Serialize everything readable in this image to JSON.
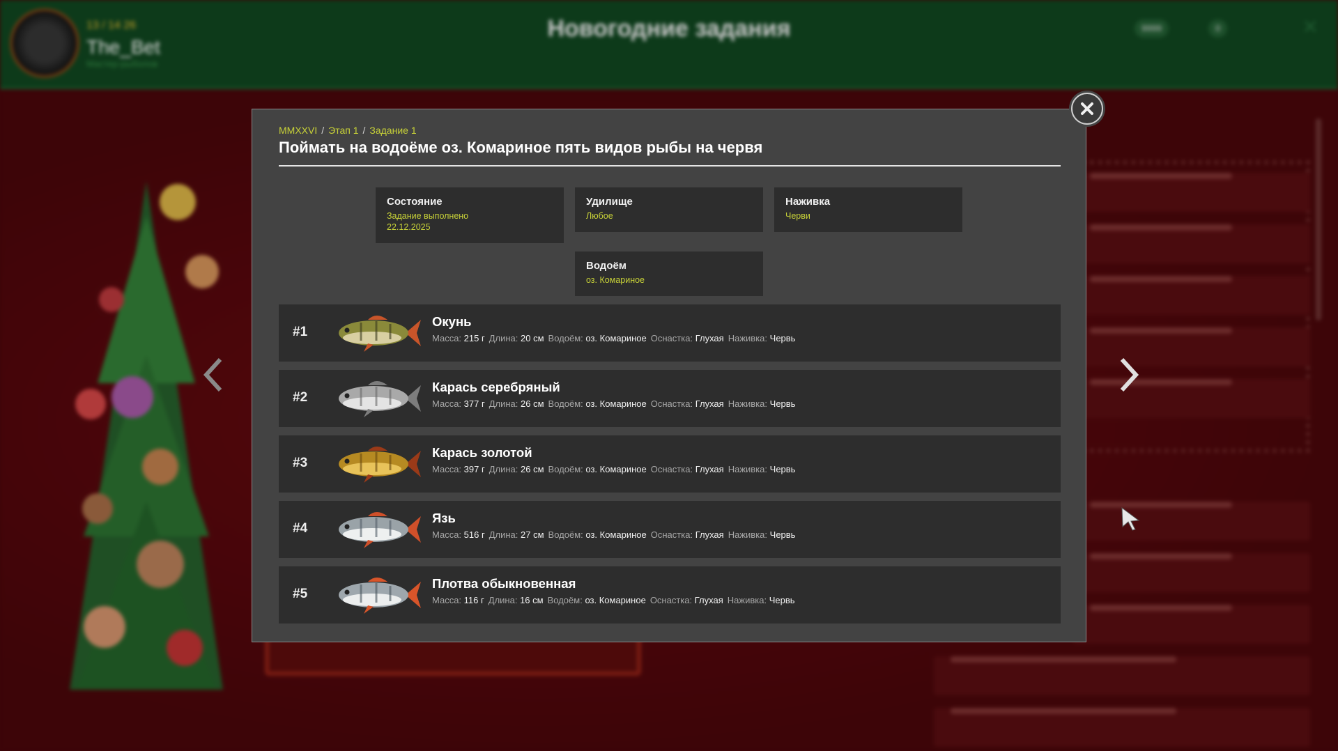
{
  "header": {
    "level": "13 / 14 26",
    "player_name": "The_Bet",
    "player_sub": "Мастер-рыболов",
    "title": "Новогодние задания",
    "badge_1": "9999",
    "badge_2": "0"
  },
  "dialog": {
    "breadcrumb": [
      "MMXXVI",
      "Этап 1",
      "Задание 1"
    ],
    "title": "Поймать на водоёме оз. Комариное пять видов рыбы на червя",
    "info": {
      "state": {
        "label": "Состояние",
        "value": "Задание выполнено",
        "date": "22.12.2025"
      },
      "rod": {
        "label": "Удилище",
        "value": "Любое"
      },
      "bait": {
        "label": "Наживка",
        "value": "Черви"
      },
      "water": {
        "label": "Водоём",
        "value": "оз. Комариное"
      }
    },
    "stat_labels": {
      "mass": "Масса:",
      "length": "Длина:",
      "water": "Водоём:",
      "tackle": "Оснастка:",
      "bait": "Наживка:"
    },
    "fish": [
      {
        "rank": "#1",
        "name": "Окунь",
        "mass": "215 г",
        "length": "20 см",
        "water": "оз. Комариное",
        "tackle": "Глухая",
        "bait": "Червь",
        "colors": {
          "body": "#8a8a3a",
          "belly": "#d8cfa2",
          "fin": "#c8552a",
          "stripe": "#3b3a1e"
        }
      },
      {
        "rank": "#2",
        "name": "Карась серебряный",
        "mass": "377 г",
        "length": "26 см",
        "water": "оз. Комариное",
        "tackle": "Глухая",
        "bait": "Червь",
        "colors": {
          "body": "#a9a9a9",
          "belly": "#e4e4e4",
          "fin": "#7d7d7d",
          "stripe": "#6b6b6b"
        }
      },
      {
        "rank": "#3",
        "name": "Карась золотой",
        "mass": "397 г",
        "length": "26 см",
        "water": "оз. Комариное",
        "tackle": "Глухая",
        "bait": "Червь",
        "colors": {
          "body": "#b68a22",
          "belly": "#e8c35a",
          "fin": "#9a3a18",
          "stripe": "#6a4a10"
        }
      },
      {
        "rank": "#4",
        "name": "Язь",
        "mass": "516 г",
        "length": "27 см",
        "water": "оз. Комариное",
        "tackle": "Глухая",
        "bait": "Червь",
        "colors": {
          "body": "#9aa3a8",
          "belly": "#eef0f0",
          "fin": "#d0502a",
          "stripe": "#55606a"
        }
      },
      {
        "rank": "#5",
        "name": "Плотва обыкновенная",
        "mass": "116 г",
        "length": "16 см",
        "water": "оз. Комариное",
        "tackle": "Глухая",
        "bait": "Червь",
        "colors": {
          "body": "#9ea7ad",
          "belly": "#eceeee",
          "fin": "#d8552a",
          "stripe": "#4a565e"
        }
      }
    ]
  },
  "colors": {
    "accent": "#c8d238",
    "panel": "#434343",
    "row": "#2d2d2d",
    "header_bg": "#0d3a1a",
    "backdrop": "#3d0508"
  },
  "icons": {
    "close": "close-icon",
    "prev": "chevron-left-icon",
    "next": "chevron-right-icon"
  }
}
